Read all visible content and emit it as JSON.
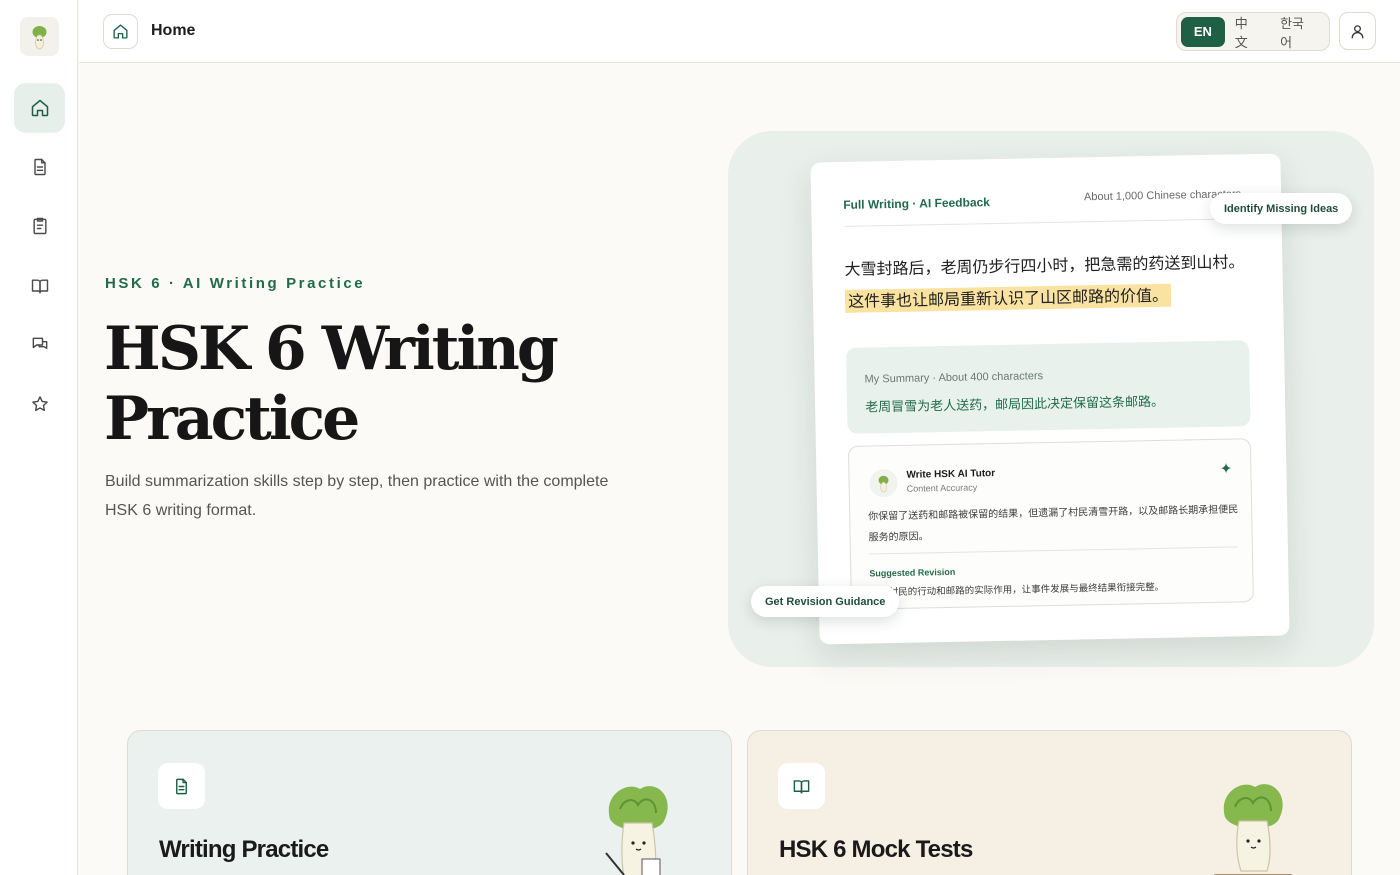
{
  "topbar": {
    "title": "Home",
    "languages": [
      "EN",
      "中文",
      "한국어"
    ],
    "active_language": "EN"
  },
  "sidebar": {
    "items": [
      {
        "icon": "home-icon",
        "active": true
      },
      {
        "icon": "document-icon",
        "active": false
      },
      {
        "icon": "clipboard-icon",
        "active": false
      },
      {
        "icon": "book-icon",
        "active": false
      },
      {
        "icon": "chat-icon",
        "active": false
      },
      {
        "icon": "star-icon",
        "active": false
      }
    ]
  },
  "hero": {
    "eyebrow": "HSK 6 · AI Writing Practice",
    "title": "HSK 6 Writing Practice",
    "subtitle": "Build summarization skills step by step, then practice with the complete HSK 6 writing format."
  },
  "preview": {
    "label": "Full Writing · AI Feedback",
    "meta": "About 1,000 Chinese characters",
    "text_plain": "大雪封路后，老周仍步行四小时，把急需的药送到山村。",
    "text_highlight": "这件事也让邮局重新认识了山区邮路的价值。",
    "summary_meta": "My Summary · About 400 characters",
    "summary_text": "老周冒雪为老人送药，邮局因此决定保留这条邮路。",
    "tutor_name": "Write HSK AI Tutor",
    "tutor_role": "Content Accuracy",
    "tutor_text": "你保留了送药和邮路被保留的结果，但遗漏了村民清雪开路，以及邮路长期承担便民服务的原因。",
    "revision_label": "Suggested Revision",
    "revision_text": "补充村民的行动和邮路的实际作用，让事件发展与最终结果衔接完整。",
    "chip_missing": "Identify Missing Ideas",
    "chip_revision": "Get Revision Guidance"
  },
  "cards": [
    {
      "title": "Writing Practice",
      "icon": "document-icon"
    },
    {
      "title": "HSK 6 Mock Tests",
      "icon": "book-icon"
    }
  ],
  "colors": {
    "accent": "#1f5f45",
    "highlight": "#fae3a1",
    "card_green": "#ebf1ee",
    "card_cream": "#f6f0e4"
  }
}
